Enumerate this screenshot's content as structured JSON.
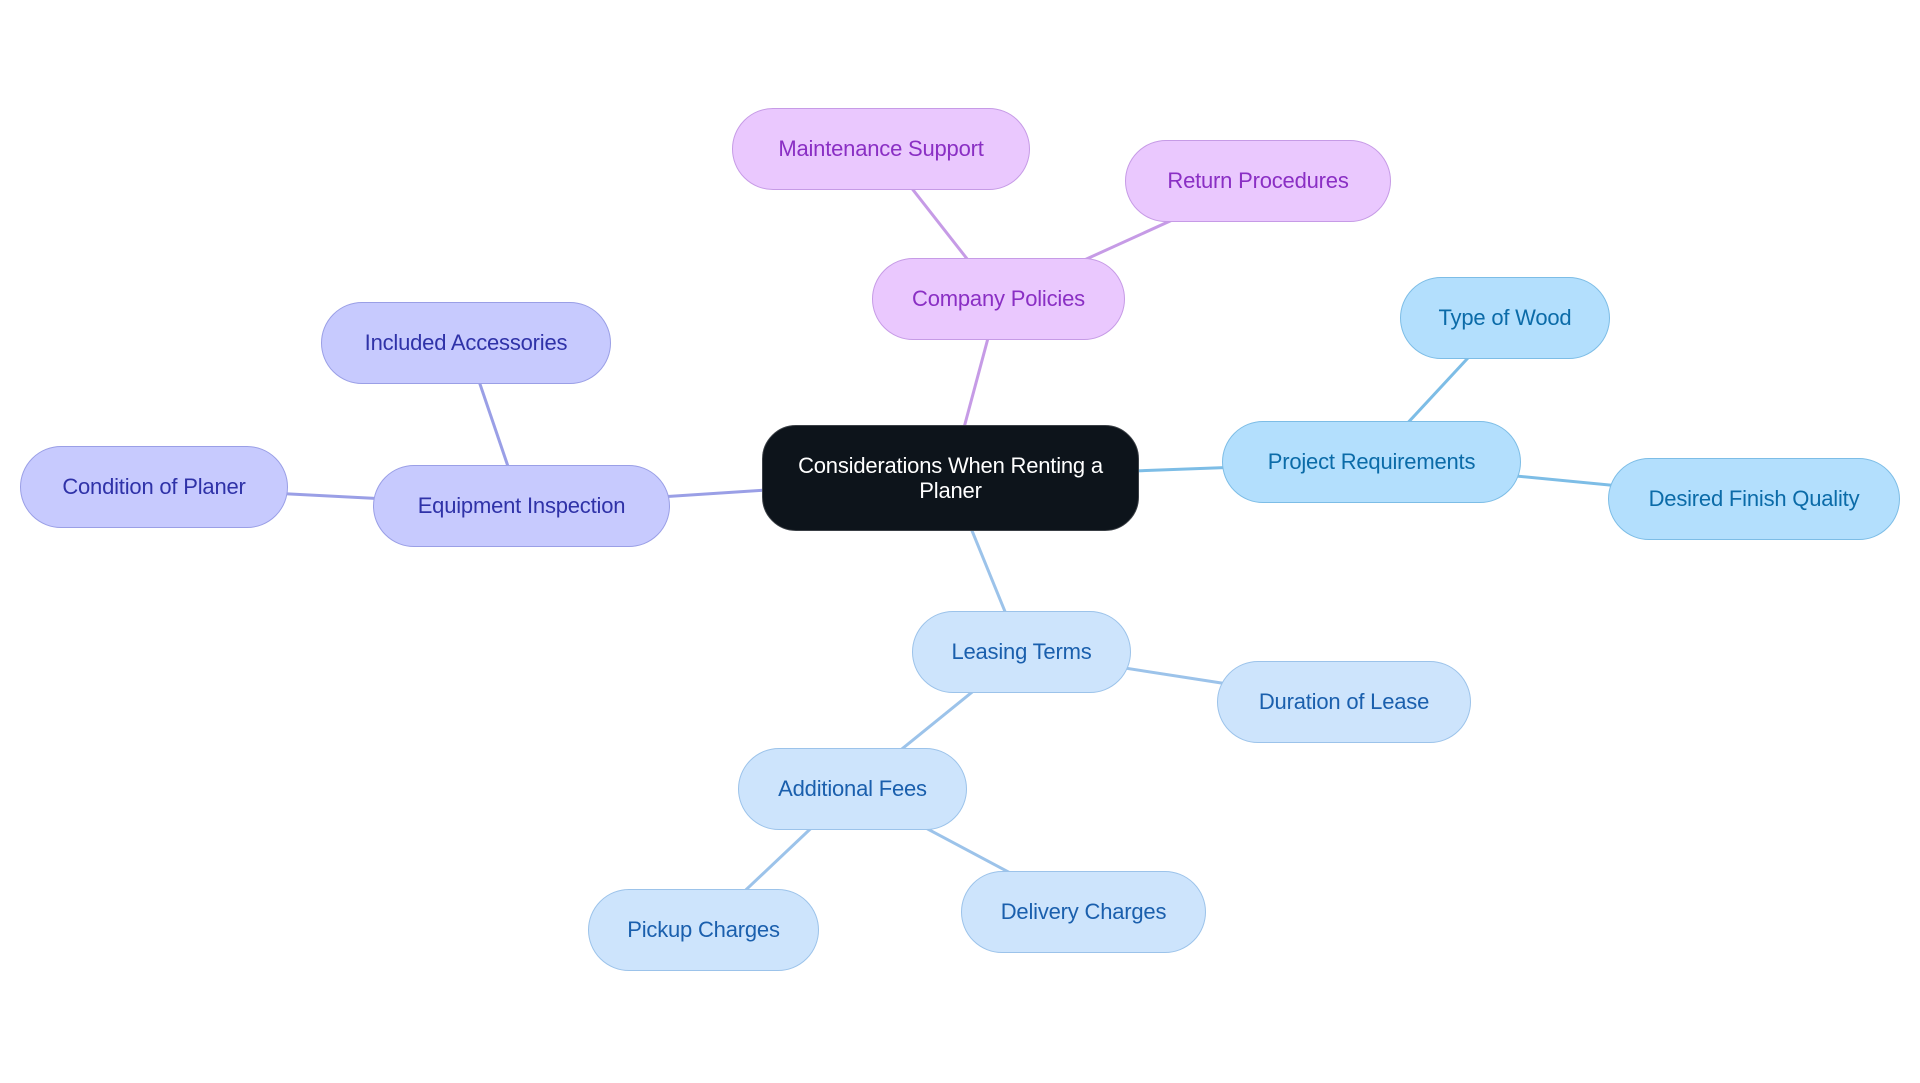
{
  "diagram": {
    "type": "mindmap",
    "root": {
      "id": "root",
      "label": "Considerations When Renting a Planer",
      "fill": "#0d141b",
      "stroke": "#3a3f45",
      "text": "#ffffff"
    },
    "branches": [
      {
        "id": "company-policies",
        "label": "Company Policies",
        "theme": "purple",
        "children": [
          {
            "id": "maintenance-support",
            "label": "Maintenance Support"
          },
          {
            "id": "return-procedures",
            "label": "Return Procedures"
          }
        ]
      },
      {
        "id": "project-requirements",
        "label": "Project Requirements",
        "theme": "sky",
        "children": [
          {
            "id": "type-of-wood",
            "label": "Type of Wood"
          },
          {
            "id": "desired-finish-quality",
            "label": "Desired Finish Quality"
          }
        ]
      },
      {
        "id": "equipment-inspection",
        "label": "Equipment Inspection",
        "theme": "indigo",
        "children": [
          {
            "id": "included-accessories",
            "label": "Included Accessories"
          },
          {
            "id": "condition-of-planer",
            "label": "Condition of Planer"
          }
        ]
      },
      {
        "id": "leasing-terms",
        "label": "Leasing Terms",
        "theme": "blue",
        "children": [
          {
            "id": "duration-of-lease",
            "label": "Duration of Lease"
          },
          {
            "id": "additional-fees",
            "label": "Additional Fees",
            "children": [
              {
                "id": "pickup-charges",
                "label": "Pickup Charges"
              },
              {
                "id": "delivery-charges",
                "label": "Delivery Charges"
              }
            ]
          }
        ]
      }
    ],
    "themes": {
      "purple": {
        "fill": "#eac8fe",
        "stroke": "#c69be6",
        "text": "#8a2fc4",
        "edge": "#c69be6"
      },
      "sky": {
        "fill": "#b3dffd",
        "stroke": "#7dbde6",
        "text": "#0b6ba8",
        "edge": "#7dbde6"
      },
      "indigo": {
        "fill": "#c7cafe",
        "stroke": "#9a9fe6",
        "text": "#2f32a8",
        "edge": "#9a9fe6"
      },
      "blue": {
        "fill": "#cde4fc",
        "stroke": "#9cc3ea",
        "text": "#1a5fad",
        "edge": "#9cc3ea"
      }
    }
  }
}
